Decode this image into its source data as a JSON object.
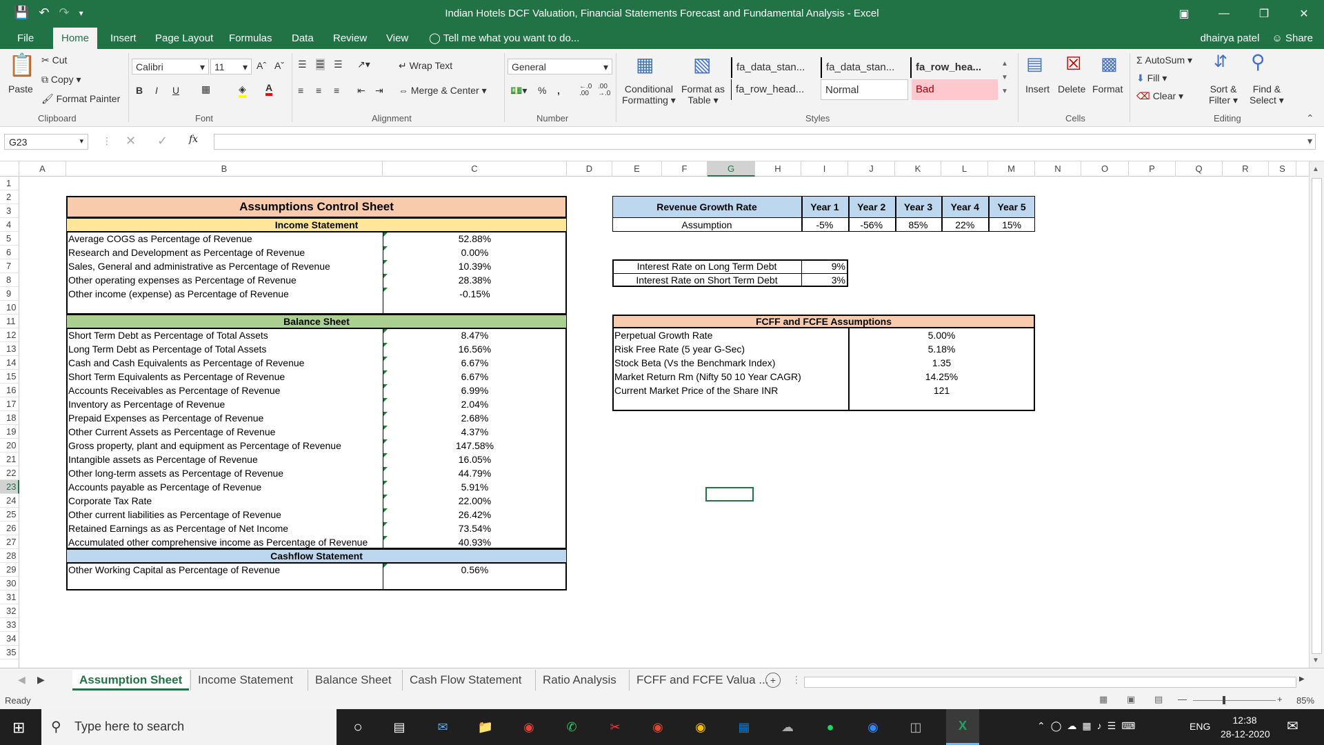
{
  "window": {
    "title": "Indian Hotels DCF Valuation, Financial Statements Forecast and Fundamental Analysis - Excel"
  },
  "tabs": [
    "File",
    "Home",
    "Insert",
    "Page Layout",
    "Formulas",
    "Data",
    "Review",
    "View"
  ],
  "tell_me": "Tell me what you want to do...",
  "user": "dhairya patel",
  "share": "Share",
  "ribbon": {
    "clipboard": {
      "paste": "Paste",
      "cut": "Cut",
      "copy": "Copy",
      "format_painter": "Format Painter",
      "label": "Clipboard"
    },
    "font": {
      "name": "Calibri",
      "size": "11",
      "label": "Font"
    },
    "alignment": {
      "wrap": "Wrap Text",
      "merge": "Merge & Center",
      "label": "Alignment"
    },
    "number": {
      "format": "General",
      "label": "Number"
    },
    "styles": {
      "conditional": "Conditional",
      "conditional2": "Formatting",
      "format_as": "Format as",
      "format_as2": "Table",
      "cells": [
        "fa_data_stan...",
        "fa_data_stan...",
        "fa_row_hea...",
        "fa_row_head...",
        "Normal",
        "Bad"
      ],
      "label": "Styles"
    },
    "cells": {
      "insert": "Insert",
      "delete": "Delete",
      "format": "Format",
      "label": "Cells"
    },
    "editing": {
      "autosum": "AutoSum",
      "fill": "Fill",
      "clear": "Clear",
      "sort": "Sort &",
      "sort2": "Filter",
      "find": "Find &",
      "find2": "Select",
      "label": "Editing"
    }
  },
  "namebox": "G23",
  "columns": [
    "A",
    "B",
    "C",
    "D",
    "E",
    "F",
    "G",
    "H",
    "I",
    "J",
    "K",
    "L",
    "M",
    "N",
    "O",
    "P",
    "Q",
    "R",
    "S"
  ],
  "rows": [
    "1",
    "2",
    "3",
    "4",
    "5",
    "6",
    "7",
    "8",
    "9",
    "10",
    "11",
    "12",
    "13",
    "14",
    "15",
    "16",
    "17",
    "18",
    "19",
    "20",
    "21",
    "22",
    "23",
    "24",
    "25",
    "26",
    "27",
    "28",
    "29",
    "30",
    "31",
    "32",
    "33",
    "34",
    "35"
  ],
  "sheet": {
    "title": "Assumptions Control Sheet",
    "income_header": "Income Statement",
    "income": [
      {
        "label": "Average COGS as Percentage of Revenue",
        "value": "52.88%"
      },
      {
        "label": "Research and Development as Percentage of Revenue",
        "value": "0.00%"
      },
      {
        "label": "Sales, General and administrative as Percentage of Revenue",
        "value": "10.39%"
      },
      {
        "label": "Other operating expenses as Percentage of Revenue",
        "value": "28.38%"
      },
      {
        "label": "Other income (expense) as Percentage of Revenue",
        "value": "-0.15%"
      }
    ],
    "balance_header": "Balance Sheet",
    "balance": [
      {
        "label": "Short Term Debt as Percentage of Total Assets",
        "value": "8.47%"
      },
      {
        "label": "Long Term Debt as Percentage of Total Assets",
        "value": "16.56%"
      },
      {
        "label": "Cash and Cash Equivalents as Percentage of Revenue",
        "value": "6.67%"
      },
      {
        "label": "Short Term Equivalents as Percentage of Revenue",
        "value": "6.67%"
      },
      {
        "label": "Accounts Receivables as Percentage of Revenue",
        "value": "6.99%"
      },
      {
        "label": "Inventory as Percentage of Revenue",
        "value": "2.04%"
      },
      {
        "label": "Prepaid Expenses as Percentage of Revenue",
        "value": "2.68%"
      },
      {
        "label": "Other Current Assets as Percentage of Revenue",
        "value": "4.37%"
      },
      {
        "label": "Gross property, plant and equipment as Percentage of Revenue",
        "value": "147.58%"
      },
      {
        "label": "Intangible assets as Percentage of Revenue",
        "value": "16.05%"
      },
      {
        "label": "Other long-term assets as Percentage of Revenue",
        "value": "44.79%"
      },
      {
        "label": "Accounts payable as Percentage of Revenue",
        "value": "5.91%"
      },
      {
        "label": "Corporate Tax Rate",
        "value": "22.00%"
      },
      {
        "label": "Other current liabilities as Percentage of Revenue",
        "value": "26.42%"
      },
      {
        "label": "Retained Earnings as as Percentage of Net Income",
        "value": "73.54%"
      },
      {
        "label": "Accumulated other comprehensive income as Percentage of Revenue",
        "value": "40.93%"
      }
    ],
    "cashflow_header": "Cashflow Statement",
    "cashflow": [
      {
        "label": "Other Working Capital as Percentage of Revenue",
        "value": "0.56%"
      }
    ],
    "growth": {
      "header": "Revenue Growth Rate",
      "years": [
        "Year 1",
        "Year 2",
        "Year 3",
        "Year 4",
        "Year 5"
      ],
      "row_label": "Assumption",
      "values": [
        "-5%",
        "-56%",
        "85%",
        "22%",
        "15%"
      ]
    },
    "interest": [
      {
        "label": "Interest Rate on Long Term Debt",
        "value": "9%"
      },
      {
        "label": "Interest Rate on Short Term Debt",
        "value": "3%"
      }
    ],
    "fcff": {
      "header": "FCFF and FCFE Assumptions",
      "items": [
        {
          "label": "Perpetual Growth Rate",
          "value": "5.00%"
        },
        {
          "label": "Risk Free Rate (5 year G-Sec)",
          "value": "5.18%"
        },
        {
          "label": "Stock Beta (Vs the Benchmark Index)",
          "value": "1.35"
        },
        {
          "label": "Market Return Rm (Nifty 50 10 Year CAGR)",
          "value": "14.25%"
        },
        {
          "label": "Current Market Price of the Share INR",
          "value": "121"
        }
      ]
    }
  },
  "sheet_tabs": [
    "Assumption Sheet",
    "Income Statement",
    "Balance Sheet",
    "Cash Flow Statement",
    "Ratio Analysis",
    "FCFF and FCFE Valua ..."
  ],
  "status": {
    "ready": "Ready",
    "zoom": "85%"
  },
  "taskbar": {
    "search": "Type here to search",
    "lang": "ENG",
    "time": "12:38",
    "date": "28-12-2020"
  },
  "colors": {
    "excel_green": "#217346",
    "title_fill": "#f8cbad",
    "income_fill": "#ffe699",
    "balance_fill": "#a9d08e",
    "cashflow_fill": "#bdd7ee",
    "growth_fill": "#bdd7ee",
    "fcff_fill": "#f8cbad",
    "bad_fill": "#ffc7ce"
  }
}
